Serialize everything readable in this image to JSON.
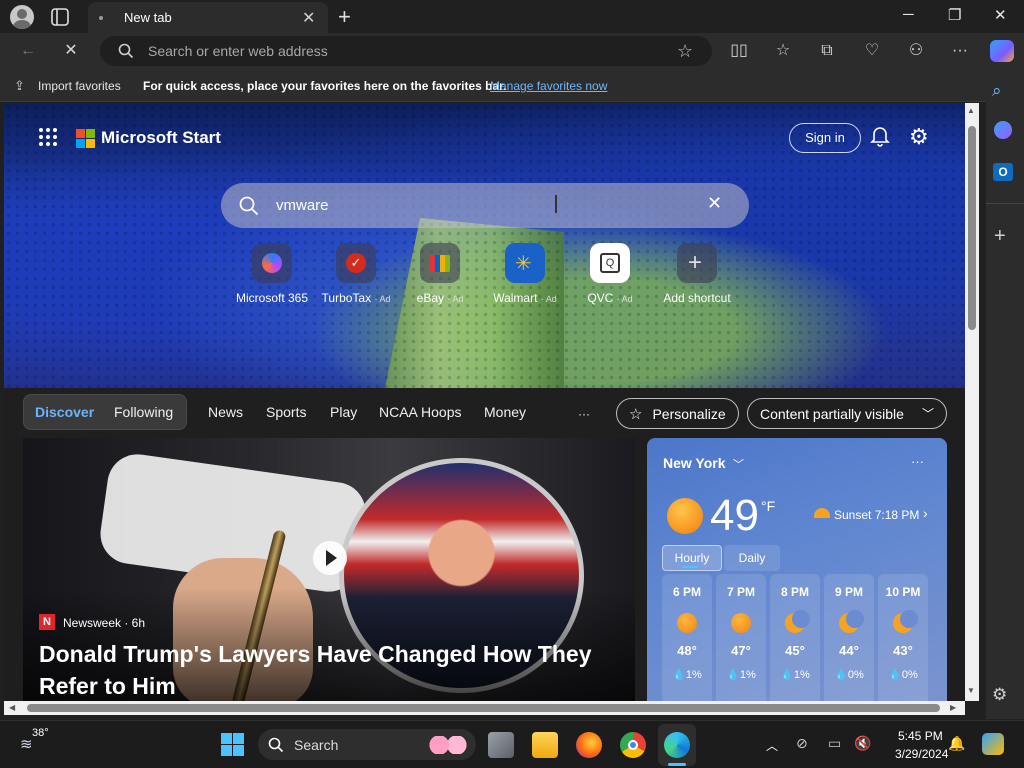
{
  "browser": {
    "tab_title": "New tab",
    "address_placeholder": "Search or enter web address",
    "favbar_import": "Import favorites",
    "favbar_hint": "For quick access, place your favorites here on the favorites bar.",
    "favbar_link": "Manage favorites now"
  },
  "start": {
    "brand": "Microsoft Start",
    "sign_in": "Sign in",
    "search_value": "vmware",
    "shortcuts": [
      {
        "label": "Microsoft 365",
        "ad": ""
      },
      {
        "label": "TurboTax",
        "ad": "· Ad"
      },
      {
        "label": "eBay",
        "ad": "· Ad"
      },
      {
        "label": "Walmart",
        "ad": "· Ad"
      },
      {
        "label": "QVC",
        "ad": "· Ad"
      },
      {
        "label": "Add shortcut",
        "ad": ""
      }
    ],
    "nav": {
      "discover": "Discover",
      "following": "Following",
      "items": [
        "News",
        "Sports",
        "Play",
        "NCAA Hoops",
        "Money"
      ],
      "more": "···",
      "personalize": "Personalize",
      "content_visibility": "Content partially visible"
    },
    "story": {
      "source_logo": "N",
      "source": "Newsweek · 6h",
      "headline": "Donald Trump's Lawyers Have Changed How They Refer to Him"
    },
    "weather": {
      "location": "New York",
      "temp": "49",
      "unit": "°F",
      "sunset": "Sunset 7:18 PM",
      "tab_hourly": "Hourly",
      "tab_daily": "Daily",
      "hours": [
        {
          "time": "6 PM",
          "icon": "sun-icon",
          "temp": "48°",
          "precip": "1%"
        },
        {
          "time": "7 PM",
          "icon": "sun-icon",
          "temp": "47°",
          "precip": "1%"
        },
        {
          "time": "8 PM",
          "icon": "moon-icon",
          "temp": "45°",
          "precip": "1%"
        },
        {
          "time": "9 PM",
          "icon": "moon-icon",
          "temp": "44°",
          "precip": "0%"
        },
        {
          "time": "10 PM",
          "icon": "moon-icon",
          "temp": "43°",
          "precip": "0%"
        }
      ]
    }
  },
  "taskbar": {
    "weather_temp": "38°",
    "search_label": "Search",
    "time": "5:45 PM",
    "date": "3/29/2024"
  },
  "colors": {
    "accent": "#4cc2ff",
    "link": "#6cb8ff",
    "discover": "#6ab4ff"
  }
}
